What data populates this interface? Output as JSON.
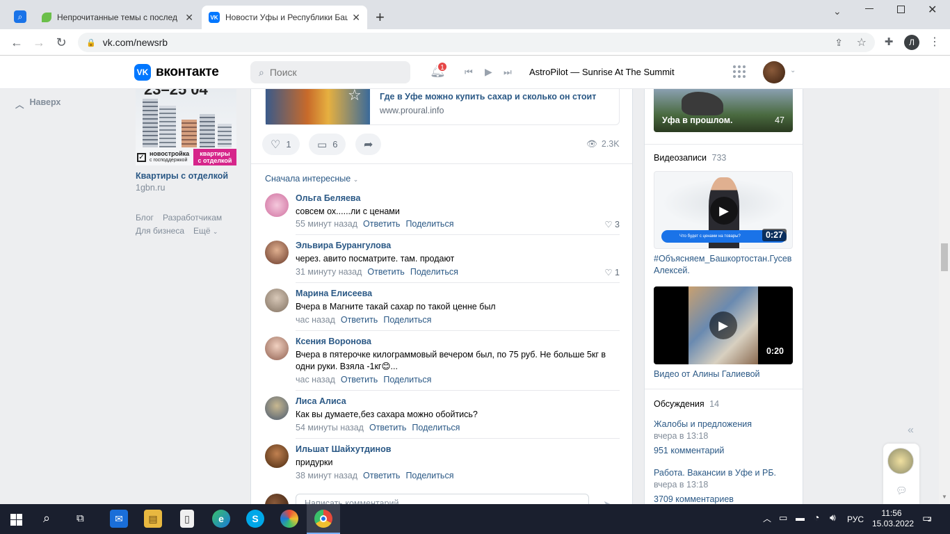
{
  "browser": {
    "tabs": [
      {
        "title": "Непрочитанные темы с послед",
        "active": false
      },
      {
        "title": "Новости Уфы и Республики Баш",
        "active": true
      }
    ],
    "new_tab": "+",
    "url": "vk.com/newsrb",
    "profile_initial": "Л"
  },
  "vk": {
    "logo_text": "вконтакте",
    "search_placeholder": "Поиск",
    "notif_count": "1",
    "player_track": "AstroPilot — Sunrise At The Summit"
  },
  "left": {
    "back_to_top": "Наверх",
    "ad": {
      "banner_date": "23–25 04",
      "banner_line1": "новостройка",
      "banner_line2": "с господдержкой",
      "banner_badge1": "квартиры",
      "banner_badge2": "с отделкой",
      "title": "Квартиры с отделкой",
      "domain": "1gbn.ru"
    },
    "footer_links": [
      "Блог",
      "Разработчикам",
      "Для бизнеса",
      "Ещё"
    ]
  },
  "post": {
    "link_title": "Где в Уфе можно купить сахар и сколько он стоит",
    "link_domain": "www.proural.info",
    "likes": "1",
    "comments": "6",
    "views": "2.3K",
    "sort_label": "Сначала интересные"
  },
  "comments": [
    {
      "name": "Ольга Беляева",
      "text": "совсем ох......ли с ценами",
      "time": "55 минут назад",
      "reply": "Ответить",
      "share": "Поделиться",
      "likes": "3",
      "avatar_color": "#e8a0c0"
    },
    {
      "name": "Эльвира Бурангулова",
      "text": "через. авито посматрите. там. продают",
      "time": "31 минуту назад",
      "reply": "Ответить",
      "share": "Поделиться",
      "likes": "1",
      "avatar_color": "#8a4a3a"
    },
    {
      "name": "Марина Елисеева",
      "text": "Вчера в Магните такай сахар по такой ценне был",
      "time": "час назад",
      "reply": "Ответить",
      "share": "Поделиться",
      "likes": "",
      "avatar_color": "#9a8878"
    },
    {
      "name": "Ксения Воронова",
      "text": "Вчера в пятерочке килограммовый вечером был, по 75 руб. Не больше 5кг в одни руки. Взяла -1кг😊...",
      "time": "час назад",
      "reply": "Ответить",
      "share": "Поделиться",
      "likes": "",
      "avatar_color": "#b08070"
    },
    {
      "name": "Лиса Алиса",
      "text": "Как вы думаете,без сахара можно обойтись?",
      "time": "54 минуты назад",
      "reply": "Ответить",
      "share": "Поделиться",
      "likes": "",
      "avatar_color": "#6a7a90"
    },
    {
      "name": "Ильшат Шайхутдинов",
      "text": "придурки",
      "time": "38 минут назад",
      "reply": "Ответить",
      "share": "Поделиться",
      "likes": "",
      "avatar_color": "#7a4a2a"
    }
  ],
  "comment_input_placeholder": "Написать комментарий...",
  "right": {
    "album_caption": "Уфа в прошлом.",
    "album_count": "47",
    "videos_title": "Видеозаписи",
    "videos_count": "733",
    "videos": [
      {
        "duration": "0:27",
        "title": "#Объясняем_Башкортостан.Гусев Алексей.",
        "overlay": "Что будет с ценами на товары?"
      },
      {
        "duration": "0:20",
        "title": "Видео от Алины Галиевой"
      }
    ],
    "discussions_title": "Обсуждения",
    "discussions_count": "14",
    "discussions": [
      {
        "title": "Жалобы и предложения",
        "time": "вчера в 13:18",
        "count": "951 комментарий"
      },
      {
        "title": "Работа. Вакансии в Уфе и РБ.",
        "time": "вчера в 13:18",
        "count": "3709 комментариев"
      }
    ]
  },
  "taskbar": {
    "lang": "РУС",
    "time": "11:56",
    "date": "15.03.2022",
    "notif": "2"
  }
}
